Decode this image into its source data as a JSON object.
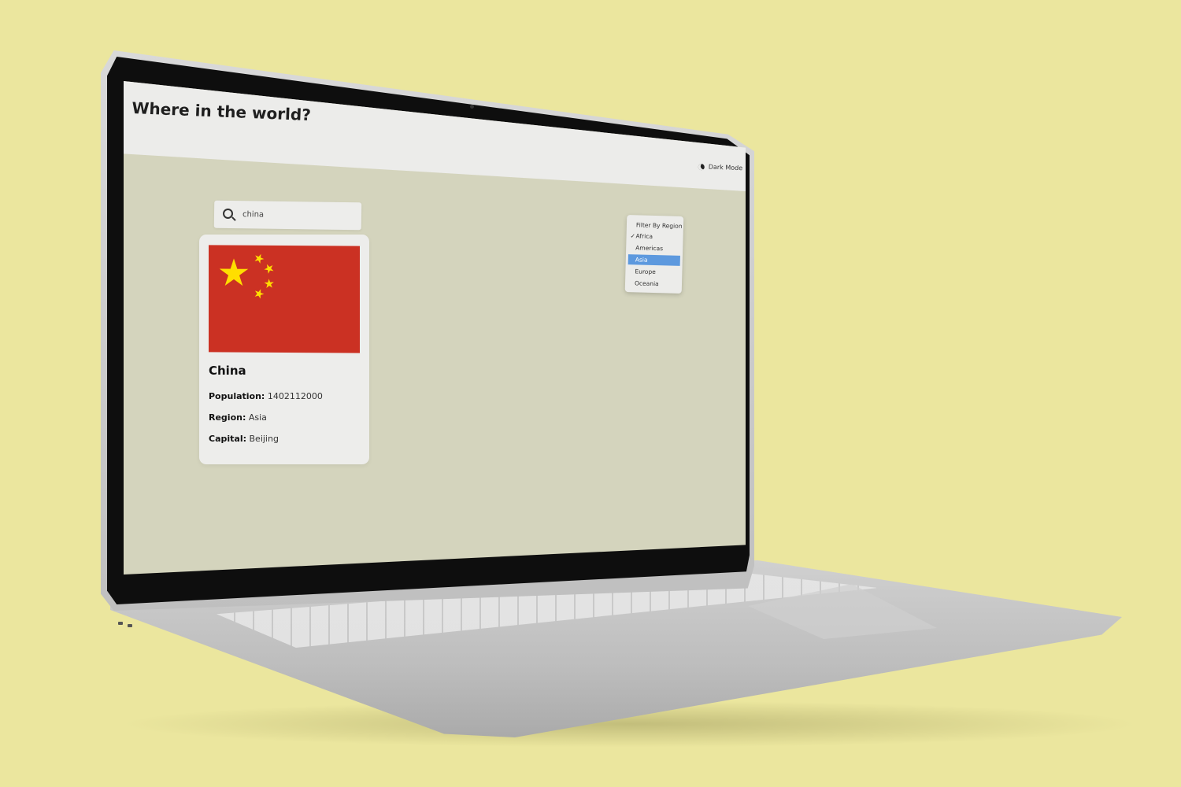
{
  "header": {
    "title": "Where in the world?",
    "dark_mode_label": "Dark Mode"
  },
  "search": {
    "value": "china",
    "icon": "search-icon"
  },
  "filter": {
    "placeholder": "Filter By Region",
    "options": [
      "Africa",
      "Americas",
      "Asia",
      "Europe",
      "Oceania"
    ],
    "checked": "Africa",
    "highlighted": "Asia",
    "highlight_color": "#5d99de"
  },
  "card": {
    "name": "China",
    "population_label": "Population:",
    "population": "1402112000",
    "region_label": "Region:",
    "region": "Asia",
    "capital_label": "Capital:",
    "capital": "Beijing",
    "flag_colors": {
      "red": "#de2910",
      "yellow": "#ffde00"
    }
  },
  "colors": {
    "background": "#ebe69e",
    "page": "#d4d4bd",
    "header": "#ececea"
  }
}
